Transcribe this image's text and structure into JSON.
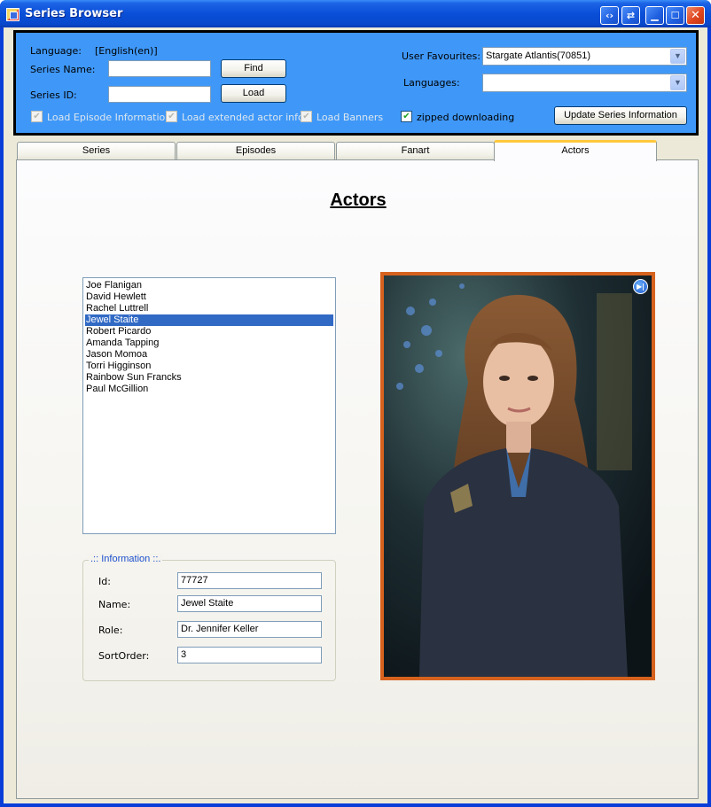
{
  "window": {
    "title": "Series Browser"
  },
  "search_panel": {
    "language_label": "Language:",
    "language_value": "[English(en)]",
    "series_name_label": "Series Name:",
    "series_name_value": "",
    "series_id_label": "Series ID:",
    "series_id_value": "",
    "find_label": "Find",
    "load_label": "Load",
    "user_favourites_label": "User Favourites:",
    "user_favourites_value": "Stargate Atlantis(70851)",
    "languages_label": "Languages:",
    "languages_value": "",
    "checkboxes": [
      {
        "label": "Load Episode Information",
        "checked": true,
        "enabled": false
      },
      {
        "label": "Load extended actor info",
        "checked": true,
        "enabled": false
      },
      {
        "label": "Load Banners",
        "checked": true,
        "enabled": false
      },
      {
        "label": "zipped downloading",
        "checked": true,
        "enabled": true
      }
    ],
    "update_label": "Update Series Information"
  },
  "tabs": [
    {
      "label": "Series",
      "active": false
    },
    {
      "label": "Episodes",
      "active": false
    },
    {
      "label": "Fanart",
      "active": false
    },
    {
      "label": "Actors",
      "active": true
    }
  ],
  "actors_page": {
    "heading": "Actors",
    "actors": [
      "Joe Flanigan",
      "David Hewlett",
      "Rachel Luttrell",
      "Jewel Staite",
      "Robert Picardo",
      "Amanda Tapping",
      "Jason Momoa",
      "Torri Higginson",
      "Rainbow Sun Francks",
      "Paul McGillion"
    ],
    "selected_index": 3,
    "information": {
      "title": ".:: Information ::.",
      "id_label": "Id:",
      "id_value": "77727",
      "name_label": "Name:",
      "name_value": "Jewel Staite",
      "role_label": "Role:",
      "role_value": "Dr. Jennifer Keller",
      "sortorder_label": "SortOrder:",
      "sortorder_value": "3"
    },
    "photo_icon": "next-image-icon"
  },
  "colors": {
    "panel_blue": "#3f98f8",
    "selection": "#316ac5",
    "photo_border": "#d6621e",
    "active_tab_accent": "#ffc83c"
  }
}
